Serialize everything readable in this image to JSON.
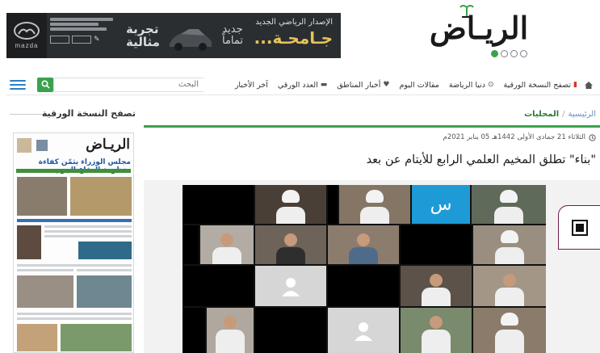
{
  "header": {
    "logo_text": "الريـاض",
    "ad": {
      "brand": "mazda",
      "dealer_line": "شركة الحاج حسين علي رضا وشركاه المحدودة",
      "dealer_en": "Haji Husein Alireza & Co. Ltd.",
      "slogan_one": "تجربة مثالية",
      "slogan_two": "جديد تماماً",
      "new_release": "الإصدار الرياضي الجديد",
      "headline": "جـامحـة..."
    }
  },
  "nav": {
    "search_placeholder": "البحث",
    "items": [
      {
        "label": "آخر الأخبار",
        "icon": ""
      },
      {
        "label": "العدد الورقي",
        "icon": "▬"
      },
      {
        "label": "أخبار المناطق",
        "icon": "♥"
      },
      {
        "label": "مقالات اليوم",
        "icon": ""
      },
      {
        "label": "دنيا الرياضة",
        "icon": "⊙"
      },
      {
        "label": "تصفح النسخة الورقية",
        "icon": "▮"
      }
    ]
  },
  "sidebar": {
    "title": "تصفح النسخة الورقية",
    "newspaper": {
      "masthead": "الريـاض",
      "headline": "مجلس الوزراء يثمّن كفاءة منظومة الدفاع الجوي"
    }
  },
  "main": {
    "breadcrumb": {
      "home": "الرئيسية",
      "separator": "/",
      "current": "المحليات"
    },
    "date": "الثلاثاء 21 جمادى الأولى 1442هـ 05 يناير 2021م",
    "title": "\"بناء\" تطلق المخيم العلمي الرابع للأيتام عن بعد",
    "video_tile_letter": "س"
  },
  "colors": {
    "accent_green": "#3aa24a",
    "link_blue": "#2d7fc1",
    "ad_background": "#2b2e31",
    "ad_gold": "#e7c25c"
  }
}
